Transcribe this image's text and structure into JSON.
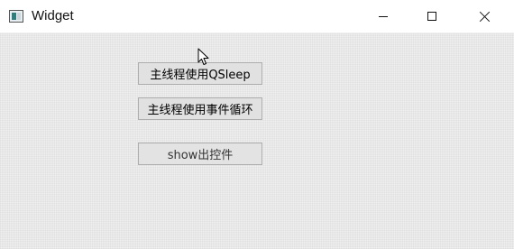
{
  "window": {
    "title": "Widget",
    "icon": "qt-widget-app-icon",
    "controls": [
      "minimize",
      "maximize",
      "close"
    ]
  },
  "buttons": {
    "qsleep_label": "主线程使用QSleep",
    "event_loop_label": "主线程使用事件循环",
    "show_label": "show出控件"
  },
  "colors": {
    "client_background": "#f0f0f0",
    "button_face": "#e1e1e1",
    "button_border": "#adadad"
  }
}
